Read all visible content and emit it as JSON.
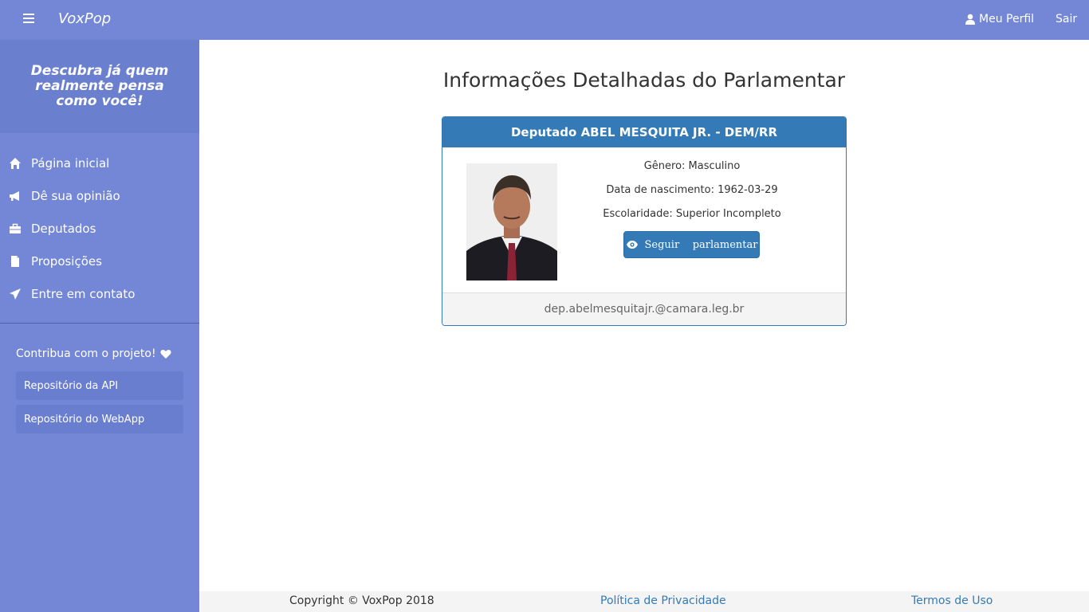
{
  "topbar": {
    "brand": "VoxPop",
    "profile_label": "Meu Perfil",
    "logout_label": "Sair"
  },
  "sidebar": {
    "tagline": "Descubra já quem realmente pensa como você!",
    "items": [
      {
        "label": "Página inicial",
        "icon": "home-icon"
      },
      {
        "label": "Dê sua opinião",
        "icon": "megaphone-icon"
      },
      {
        "label": "Deputados",
        "icon": "briefcase-icon"
      },
      {
        "label": "Proposições",
        "icon": "file-icon"
      },
      {
        "label": "Entre em contato",
        "icon": "send-icon"
      }
    ],
    "contribute_label": "Contribua com o projeto!",
    "repos": [
      {
        "label": "Repositório da API"
      },
      {
        "label": "Repositório do WebApp"
      }
    ]
  },
  "main": {
    "title": "Informações Detalhadas do Parlamentar",
    "card": {
      "header": "Deputado ABEL MESQUITA JR. - DEM/RR",
      "gender": "Gênero: Masculino",
      "birth": "Data de nascimento: 1962-03-29",
      "education": "Escolaridade: Superior Incompleto",
      "follow_label": "Seguir    parlamentar",
      "email": "dep.abelmesquitajr.@camara.leg.br"
    }
  },
  "footer": {
    "copyright": "Copyright © VoxPop 2018",
    "privacy": "Política de Privacidade",
    "terms": "Termos de Uso"
  },
  "colors": {
    "sidebar": "#7387d6",
    "primary": "#337ab7"
  }
}
